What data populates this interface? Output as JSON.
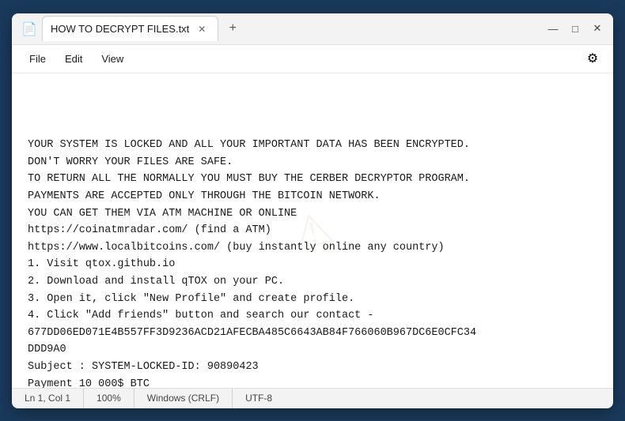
{
  "window": {
    "title": "HOW TO DECRYPT FILES.txt",
    "icon": "📄"
  },
  "tabs": [
    {
      "label": "HOW TO DECRYPT FILES.txt",
      "active": true
    }
  ],
  "controls": {
    "minimize": "—",
    "maximize": "□",
    "close": "✕",
    "new_tab": "+",
    "settings": "⚙"
  },
  "menu": {
    "items": [
      "File",
      "Edit",
      "View"
    ]
  },
  "content": {
    "text": "YOUR SYSTEM IS LOCKED AND ALL YOUR IMPORTANT DATA HAS BEEN ENCRYPTED.\nDON'T WORRY YOUR FILES ARE SAFE.\nTO RETURN ALL THE NORMALLY YOU MUST BUY THE CERBER DECRYPTOR PROGRAM.\nPAYMENTS ARE ACCEPTED ONLY THROUGH THE BITCOIN NETWORK.\nYOU CAN GET THEM VIA ATM MACHINE OR ONLINE\nhttps://coinatmradar.com/ (find a ATM)\nhttps://www.localbitcoins.com/ (buy instantly online any country)\n1. Visit qtox.github.io\n2. Download and install qTOX on your PC.\n3. Open it, click \"New Profile\" and create profile.\n4. Click \"Add friends\" button and search our contact -\n677DD06ED071E4B557FF3D9236ACD21AFECBA485C6643AB84F766060B967DC6E0CFC34\nDDD9A0\nSubject : SYSTEM-LOCKED-ID: 90890423\nPayment 10 000$ BTC"
  },
  "status_bar": {
    "position": "Ln 1, Col 1",
    "zoom": "100%",
    "line_ending": "Windows (CRLF)",
    "encoding": "UTF-8"
  }
}
